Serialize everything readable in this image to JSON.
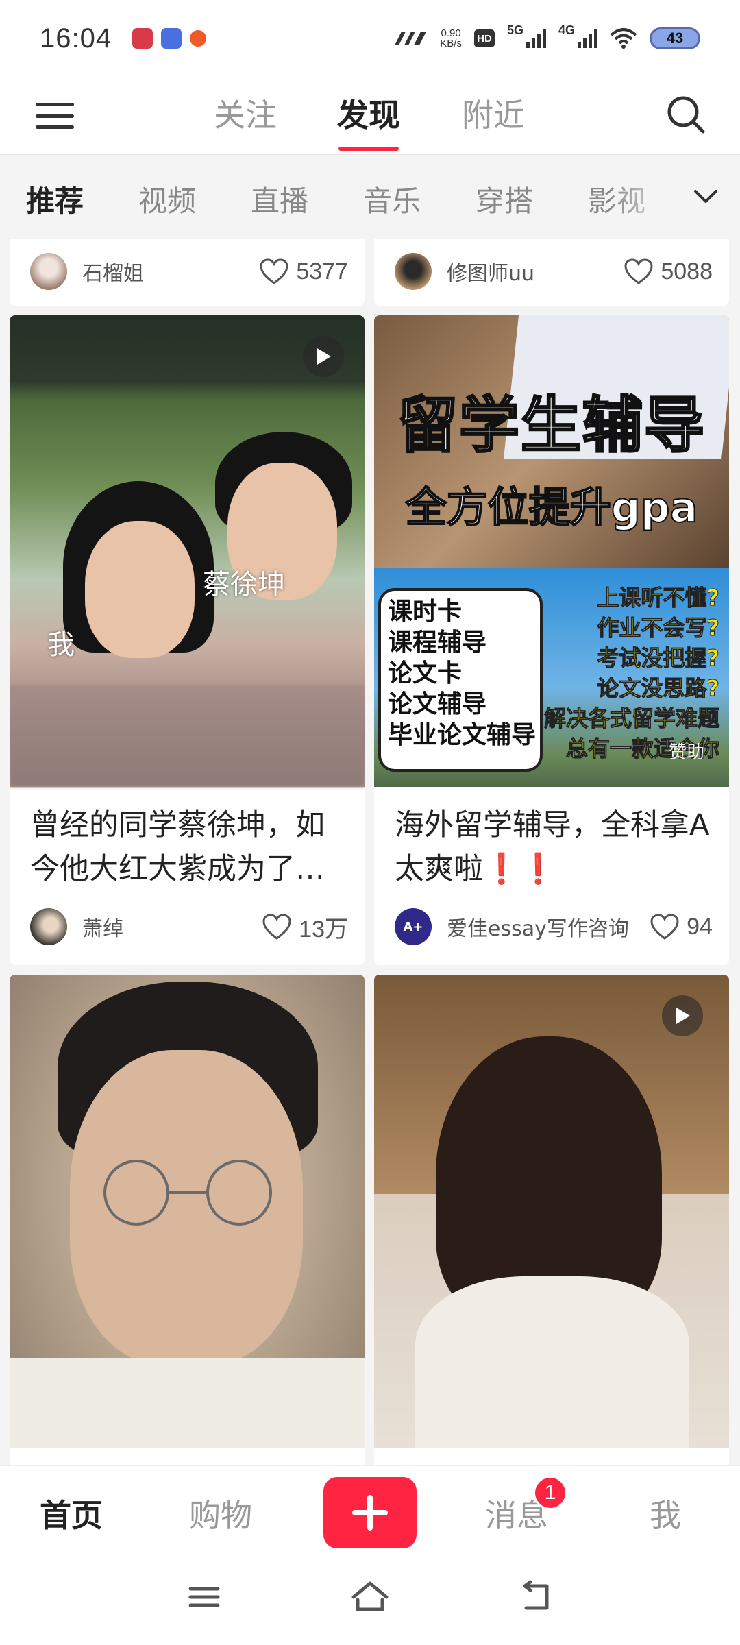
{
  "status_bar": {
    "time": "16:04",
    "net_speed_value": "0.90",
    "net_speed_unit": "KB/s",
    "hd_label": "HD",
    "hd_sub": "1",
    "signal_1": "5G",
    "signal_2": "4G",
    "battery": "43",
    "app_badge_colors": [
      "#d93a4a",
      "#4a6fe0",
      "#f05a28"
    ]
  },
  "top_nav": {
    "tabs": [
      "关注",
      "发现",
      "附近"
    ],
    "active": "发现"
  },
  "channels": {
    "items": [
      "推荐",
      "视频",
      "直播",
      "音乐",
      "穿搭",
      "影视"
    ],
    "active": "推荐"
  },
  "feed": {
    "partial_top": [
      {
        "author": "石榴姐",
        "likes": "5377"
      },
      {
        "author": "修图师uu",
        "likes": "5088"
      }
    ],
    "cards": [
      {
        "title": "曾经的同学蔡徐坤，如今他大红大紫成为了…",
        "author": "萧绰",
        "likes": "13万",
        "has_video": true,
        "overlay_labels": [
          "蔡徐坤",
          "我"
        ]
      },
      {
        "title": "海外留学辅导，全科拿A太爽啦❗❗",
        "author": "爱佳essay写作咨询",
        "likes": "94",
        "ad": {
          "headline": "留学生辅导",
          "subline": "全方位提升gpa",
          "list": [
            "课时卡",
            "课程辅导",
            "论文卡",
            "论文辅导",
            "毕业论文辅导"
          ],
          "questions": [
            "上课听不懂?",
            "作业不会写?",
            "考试没把握?",
            "论文没思路?",
            "解决各式留学难题",
            "总有一款适合你"
          ],
          "sponsor": "赞助"
        }
      },
      {
        "has_video": false
      },
      {
        "has_video": true
      }
    ]
  },
  "bottom_tabs": {
    "items": [
      "首页",
      "购物",
      "消息",
      "我"
    ],
    "active": "首页",
    "message_badge": "1"
  },
  "colors": {
    "accent": "#ff2442"
  }
}
